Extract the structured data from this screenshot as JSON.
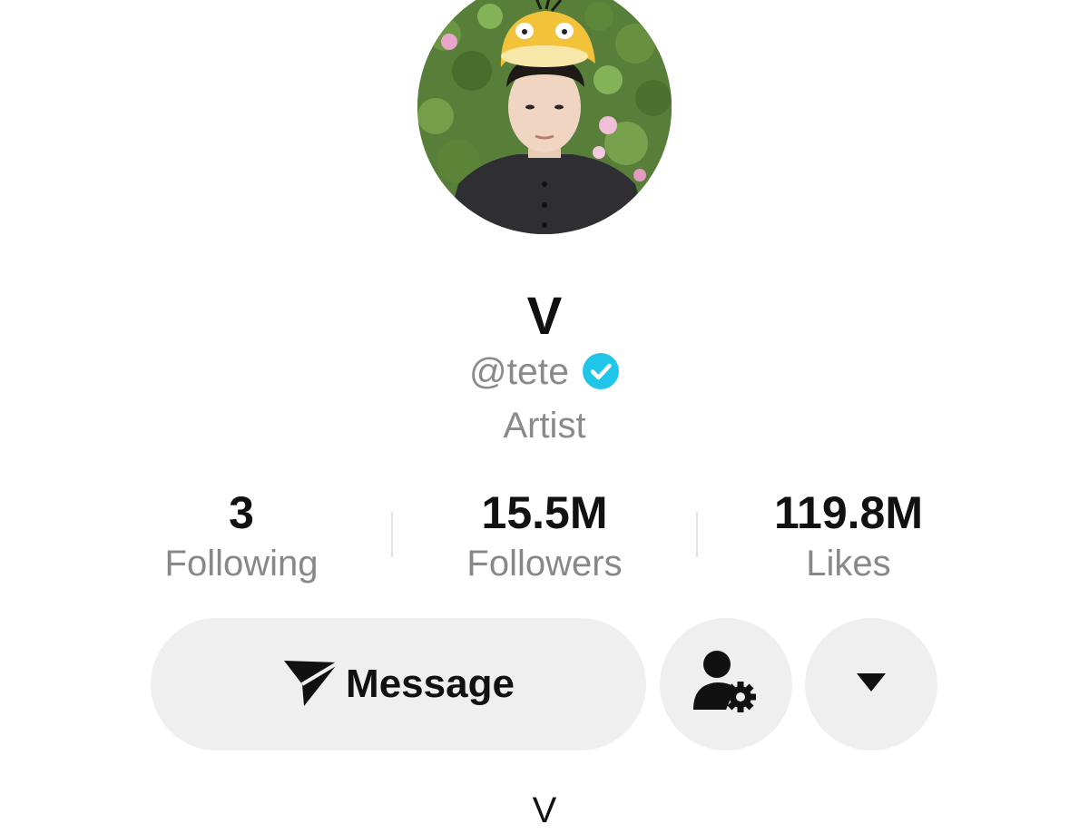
{
  "profile": {
    "display_name": "V",
    "handle": "@tete",
    "bio": "Artist",
    "verified": true
  },
  "stats": [
    {
      "value": "3",
      "label": "Following"
    },
    {
      "value": "15.5M",
      "label": "Followers"
    },
    {
      "value": "119.8M",
      "label": "Likes"
    }
  ],
  "actions": {
    "message_label": "Message",
    "message_icon": "send-icon",
    "friends_icon": "user-settings-icon",
    "more_icon": "caret-down-icon"
  },
  "tab": {
    "label": "V"
  },
  "colors": {
    "verified": "#20c5e8",
    "button_bg": "#efefef",
    "muted_text": "#8a8a8a"
  }
}
